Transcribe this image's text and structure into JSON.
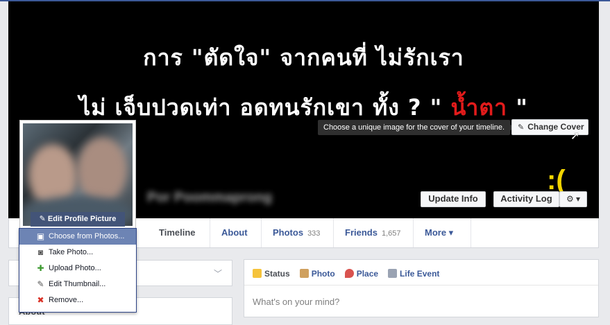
{
  "cover": {
    "line1": "การ \"ตัดใจ\" จากคนที่ ไม่รักเรา",
    "line2_prefix": "ไม่ เจ็บปวดเท่า อดทนรักเขา ทั้ง ? \"",
    "line2_red": "น้ำตา",
    "line2_suffix": "\"",
    "blurred_name": "Por Poommaprong",
    "tooltip": "Choose a unique image for the cover of your timeline.",
    "change_cover_label": "Change Cover",
    "update_info_label": "Update Info",
    "activity_log_label": "Activity Log",
    "gear_label": "⚙ ▾"
  },
  "profile": {
    "edit_label": "Edit Profile Picture"
  },
  "dropdown": {
    "items": [
      {
        "label": "Choose from Photos..."
      },
      {
        "label": "Take Photo..."
      },
      {
        "label": "Upload Photo..."
      },
      {
        "label": "Edit Thumbnail..."
      },
      {
        "label": "Remove..."
      }
    ]
  },
  "nav": {
    "tabs": [
      {
        "label": "Timeline"
      },
      {
        "label": "About"
      },
      {
        "label": "Photos",
        "count": "333"
      },
      {
        "label": "Friends",
        "count": "1,657"
      },
      {
        "label": "More ▾"
      }
    ]
  },
  "left": {
    "about_label": "About"
  },
  "composer": {
    "tabs": [
      {
        "label": "Status"
      },
      {
        "label": "Photo"
      },
      {
        "label": "Place"
      },
      {
        "label": "Life Event"
      }
    ],
    "placeholder": "What's on your mind?"
  },
  "colors": {
    "brand": "#3b5998",
    "menu_highlight": "#6d84b4",
    "cover_accent_red": "#e21b1b"
  }
}
